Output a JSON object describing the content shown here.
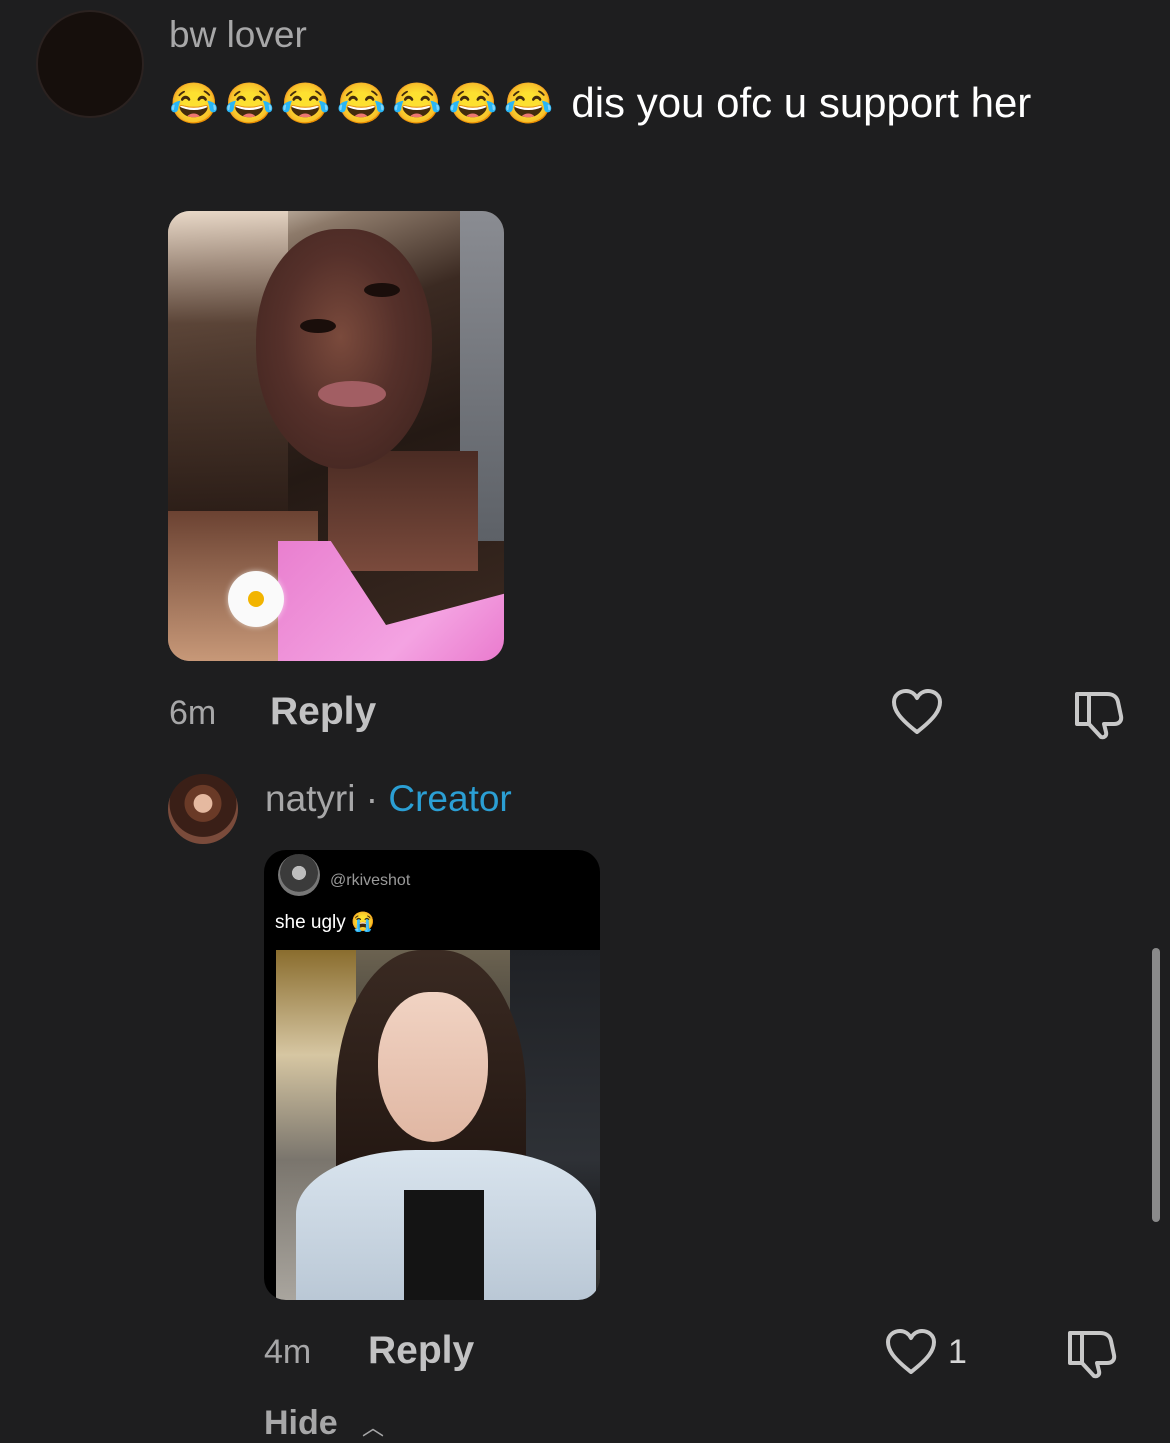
{
  "comment1": {
    "username": "bw lover",
    "emojis": [
      "😂",
      "😂",
      "😂",
      "😂",
      "😂",
      "😂",
      "😂"
    ],
    "text": "dis you ofc u support her",
    "time": "6m",
    "reply_label": "Reply"
  },
  "comment2": {
    "username": "natyri",
    "separator": "·",
    "badge": "Creator",
    "embedded_post": {
      "handle": "@rkiveshot",
      "text": "she ugly",
      "emoji": "😭"
    },
    "time": "4m",
    "reply_label": "Reply",
    "like_count": "1",
    "hide_label": "Hide"
  },
  "colors": {
    "background": "#1e1e1f",
    "creator_badge": "#2b9fd4",
    "muted_text": "#a7a7a8"
  },
  "icons": [
    "heart-icon",
    "dislike-icon",
    "chevron-up-icon"
  ]
}
